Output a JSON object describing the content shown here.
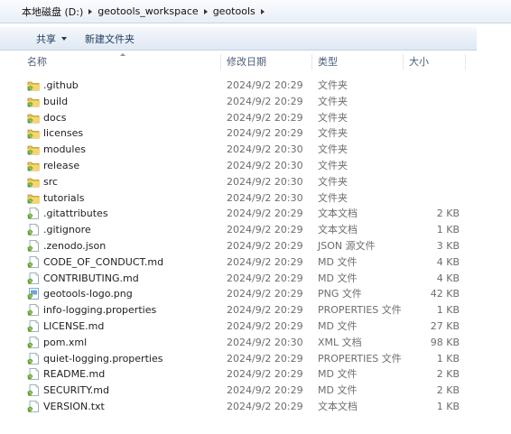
{
  "breadcrumb": [
    "本地磁盘 (D:)",
    "geotools_workspace",
    "geotools"
  ],
  "toolbar": {
    "share_label": "共享",
    "new_folder_label": "新建文件夹"
  },
  "columns": {
    "name": "名称",
    "date": "修改日期",
    "type": "类型",
    "size": "大小"
  },
  "files": [
    {
      "name": ".github",
      "date": "2024/9/2 20:29",
      "type": "文件夹",
      "size": "",
      "icon": "folder-icon"
    },
    {
      "name": "build",
      "date": "2024/9/2 20:29",
      "type": "文件夹",
      "size": "",
      "icon": "folder-icon"
    },
    {
      "name": "docs",
      "date": "2024/9/2 20:29",
      "type": "文件夹",
      "size": "",
      "icon": "folder-icon"
    },
    {
      "name": "licenses",
      "date": "2024/9/2 20:29",
      "type": "文件夹",
      "size": "",
      "icon": "folder-icon"
    },
    {
      "name": "modules",
      "date": "2024/9/2 20:30",
      "type": "文件夹",
      "size": "",
      "icon": "folder-icon"
    },
    {
      "name": "release",
      "date": "2024/9/2 20:30",
      "type": "文件夹",
      "size": "",
      "icon": "folder-icon"
    },
    {
      "name": "src",
      "date": "2024/9/2 20:30",
      "type": "文件夹",
      "size": "",
      "icon": "folder-icon"
    },
    {
      "name": "tutorials",
      "date": "2024/9/2 20:30",
      "type": "文件夹",
      "size": "",
      "icon": "folder-icon"
    },
    {
      "name": ".gitattributes",
      "date": "2024/9/2 20:29",
      "type": "文本文档",
      "size": "2 KB",
      "icon": "file-icon"
    },
    {
      "name": ".gitignore",
      "date": "2024/9/2 20:29",
      "type": "文本文档",
      "size": "1 KB",
      "icon": "file-icon"
    },
    {
      "name": ".zenodo.json",
      "date": "2024/9/2 20:29",
      "type": "JSON 源文件",
      "size": "3 KB",
      "icon": "file-icon"
    },
    {
      "name": "CODE_OF_CONDUCT.md",
      "date": "2024/9/2 20:29",
      "type": "MD 文件",
      "size": "4 KB",
      "icon": "file-icon"
    },
    {
      "name": "CONTRIBUTING.md",
      "date": "2024/9/2 20:29",
      "type": "MD 文件",
      "size": "4 KB",
      "icon": "file-icon"
    },
    {
      "name": "geotools-logo.png",
      "date": "2024/9/2 20:29",
      "type": "PNG 文件",
      "size": "42 KB",
      "icon": "image-file-icon"
    },
    {
      "name": "info-logging.properties",
      "date": "2024/9/2 20:29",
      "type": "PROPERTIES 文件",
      "size": "1 KB",
      "icon": "file-icon"
    },
    {
      "name": "LICENSE.md",
      "date": "2024/9/2 20:29",
      "type": "MD 文件",
      "size": "27 KB",
      "icon": "file-icon"
    },
    {
      "name": "pom.xml",
      "date": "2024/9/2 20:30",
      "type": "XML 文档",
      "size": "98 KB",
      "icon": "file-icon"
    },
    {
      "name": "quiet-logging.properties",
      "date": "2024/9/2 20:29",
      "type": "PROPERTIES 文件",
      "size": "1 KB",
      "icon": "file-icon"
    },
    {
      "name": "README.md",
      "date": "2024/9/2 20:29",
      "type": "MD 文件",
      "size": "2 KB",
      "icon": "file-icon"
    },
    {
      "name": "SECURITY.md",
      "date": "2024/9/2 20:29",
      "type": "MD 文件",
      "size": "2 KB",
      "icon": "file-icon"
    },
    {
      "name": "VERSION.txt",
      "date": "2024/9/2 20:29",
      "type": "文本文档",
      "size": "1 KB",
      "icon": "file-icon"
    }
  ]
}
